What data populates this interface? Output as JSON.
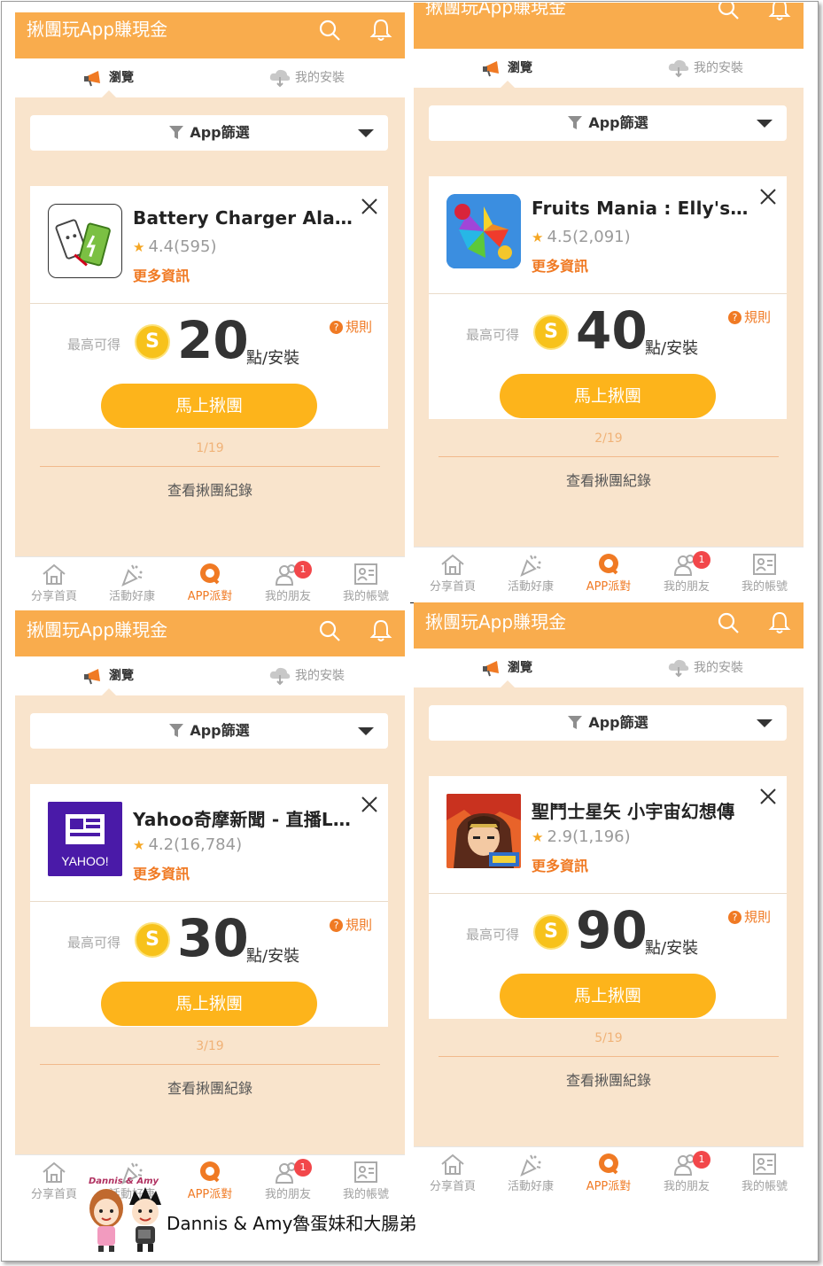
{
  "common": {
    "app_title": "揪團玩App賺現金",
    "tab_browse": "瀏覽",
    "tab_install": "我的安裝",
    "filter_label": "App篩選",
    "more_info": "更多資訊",
    "max_label": "最高可得",
    "coin_symbol": "S",
    "points_unit": "點/安裝",
    "rules": "規則",
    "join_button": "馬上揪團",
    "history": "查看揪團紀錄",
    "nav": [
      "分享首頁",
      "活動好康",
      "APP派對",
      "我的朋友",
      "我的帳號"
    ],
    "friends_badge": "1",
    "accent": "#f9ac4d",
    "button_color": "#fdb41b",
    "background": "#f9e4cc"
  },
  "panels": [
    {
      "app_name": "Battery Charger Alarm",
      "rating": "4.4(595)",
      "points": "20",
      "pager": "1/19",
      "icon": "battery-charger-icon"
    },
    {
      "app_name": "Fruits Mania : Elly's travel",
      "rating": "4.5(2,091)",
      "points": "40",
      "pager": "2/19",
      "icon": "fruits-mania-icon"
    },
    {
      "app_name": "Yahoo奇摩新聞 - 直播Li...",
      "rating": "4.2(16,784)",
      "points": "30",
      "pager": "3/19",
      "icon": "yahoo-news-icon"
    },
    {
      "app_name": "聖鬥士星矢 小宇宙幻想傳",
      "rating": "2.9(1,196)",
      "points": "90",
      "pager": "5/19",
      "icon": "saint-seiya-icon"
    }
  ],
  "watermark": {
    "logo_text": "Dannis & Amy",
    "caption": "Dannis & Amy魯蛋妹和大腸弟"
  }
}
